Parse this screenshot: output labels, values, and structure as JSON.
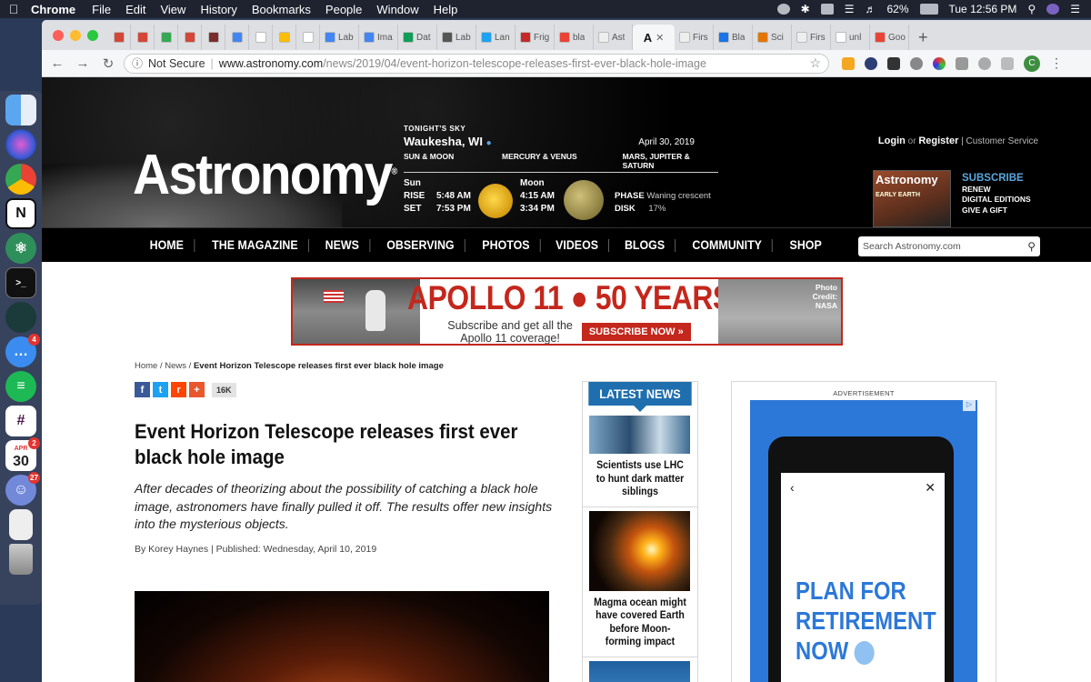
{
  "menubar": {
    "app_name": "Chrome",
    "menus": [
      "File",
      "Edit",
      "View",
      "History",
      "Bookmarks",
      "People",
      "Window",
      "Help"
    ],
    "battery": "62%",
    "clock": "Tue 12:56 PM"
  },
  "dock": {
    "badges": {
      "messages": "4",
      "calendar": "2",
      "discord": "27"
    },
    "calendar_month": "APR",
    "calendar_day": "30",
    "notion_letter": "N"
  },
  "browser": {
    "tabs": [
      {
        "label": "",
        "color": "#d44638"
      },
      {
        "label": "",
        "color": "#d44638"
      },
      {
        "label": "",
        "color": "#34a853"
      },
      {
        "label": "",
        "color": "#d44638"
      },
      {
        "label": "",
        "color": "#7b2c2c"
      },
      {
        "label": "",
        "color": "#4285f4"
      },
      {
        "label": "",
        "color": "#ffffff"
      },
      {
        "label": "",
        "color": "#fbbc04"
      },
      {
        "label": "",
        "color": "#ffffff"
      },
      {
        "label": "Lab",
        "color": "#4285f4"
      },
      {
        "label": "Ima",
        "color": "#4285f4"
      },
      {
        "label": "Dat",
        "color": "#0f9d58"
      },
      {
        "label": "Lab",
        "color": "#555555"
      },
      {
        "label": "Lan",
        "color": "#1da1f2"
      },
      {
        "label": "Frig",
        "color": "#c62828"
      },
      {
        "label": "bla",
        "color": "#ea4335"
      },
      {
        "label": "Ast",
        "color": "#eeeeee"
      }
    ],
    "active_tab_letter": "A",
    "tabs_after": [
      {
        "label": "Firs",
        "color": "#eeeeee"
      },
      {
        "label": "Bla",
        "color": "#1a73e8"
      },
      {
        "label": "Sci",
        "color": "#e37400"
      },
      {
        "label": "Firs",
        "color": "#eeeeee"
      },
      {
        "label": "unl",
        "color": "#ffffff"
      },
      {
        "label": "Goo",
        "color": "#ea4335"
      }
    ],
    "security": "Not Secure",
    "url_host": "www.astronomy.com",
    "url_path": "/news/2019/04/event-horizon-telescope-releases-first-ever-black-hole-image",
    "profile_initial": "C"
  },
  "site": {
    "logo": "Astronomy",
    "tonight": {
      "label": "TONIGHT'S SKY",
      "location": "Waukesha, WI",
      "date": "April 30, 2019",
      "col1": "SUN & MOON",
      "col2": "MERCURY & VENUS",
      "col3": "MARS, JUPITER & SATURN",
      "sun_label": "Sun",
      "moon_label": "Moon",
      "rise_label": "RISE",
      "set_label": "SET",
      "sun_rise": "5:48 AM",
      "sun_set": "7:53 PM",
      "moon_rise": "4:15 AM",
      "moon_set": "3:34 PM",
      "phase_label": "PHASE",
      "phase": "Waning crescent",
      "disk_label": "DISK",
      "disk": "17%"
    },
    "account": {
      "login": "Login",
      "or": "or",
      "register": "Register",
      "service": "Customer Service"
    },
    "subscribe": {
      "heading": "SUBSCRIBE",
      "renew": "RENEW",
      "digital": "DIGITAL EDITIONS",
      "gift": "GIVE A GIFT",
      "cover_title": "Astronomy",
      "cover_text": "EARLY EARTH"
    },
    "nav": [
      "HOME",
      "THE MAGAZINE",
      "NEWS",
      "OBSERVING",
      "PHOTOS",
      "VIDEOS",
      "BLOGS",
      "COMMUNITY",
      "SHOP"
    ],
    "search_placeholder": "Search Astronomy.com"
  },
  "banner": {
    "headline": "APOLLO 11 ● 50 YEARS",
    "line1": "Subscribe and get all the",
    "line2": "Apollo 11 coverage!",
    "cta": "SUBSCRIBE NOW »",
    "credit1": "Photo",
    "credit2": "Credit:",
    "credit3": "NASA"
  },
  "article": {
    "crumb_home": "Home",
    "crumb_news": "News",
    "crumb_current": "Event Horizon Telescope releases first ever black hole image",
    "share_count": "16K",
    "title": "Event Horizon Telescope releases first ever black hole image",
    "dek": "After decades of theorizing about the possibility of catching a black hole image, astronomers have finally pulled it off. The results offer new insights into the mysterious objects.",
    "byline": "By Korey Haynes  |  Published: Wednesday, April 10, 2019"
  },
  "latest_news": {
    "heading": "LATEST NEWS",
    "items": [
      {
        "caption": "Scientists use LHC to hunt dark matter siblings"
      },
      {
        "caption": "Magma ocean might have covered Earth before Moon-forming impact"
      }
    ]
  },
  "ad": {
    "label": "ADVERTISEMENT",
    "headline1": "PLAN FOR",
    "headline2": "RETIREMENT",
    "headline3": "NOW"
  }
}
